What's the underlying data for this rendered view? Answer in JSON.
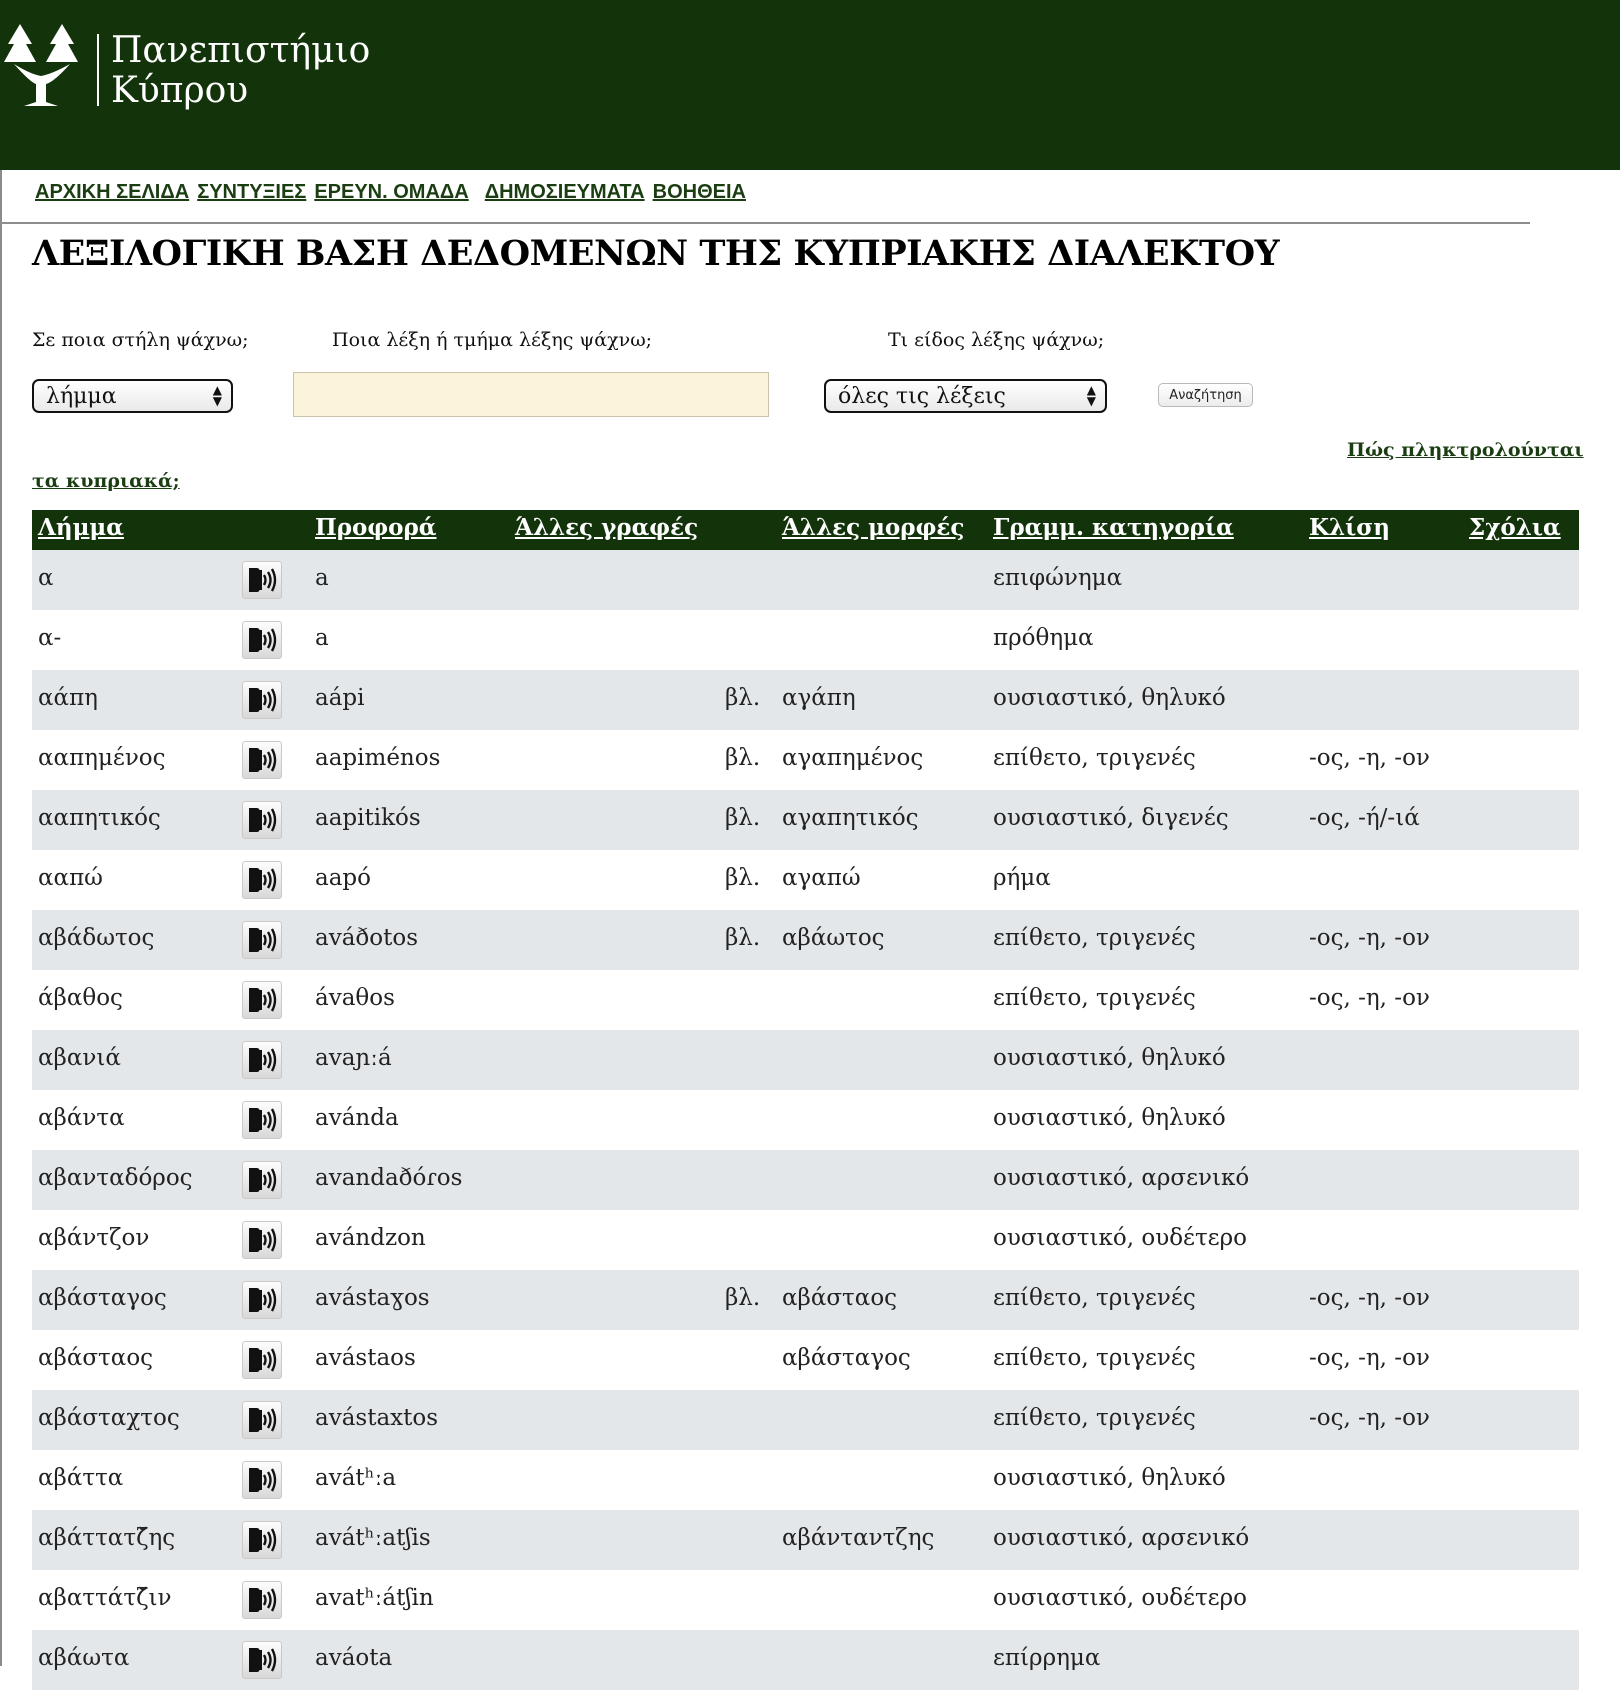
{
  "header": {
    "logo_line1": "Πανεπιστήμιο",
    "logo_line2": "Κύπρου",
    "bg_color": "#13340b"
  },
  "nav": {
    "items": [
      {
        "label": "ΑΡΧΙΚΗ ΣΕΛΙΔΑ"
      },
      {
        "label": "ΣΥΝΤΥΞΙΕΣ"
      },
      {
        "label": "ΕΡΕΥΝ. ΟΜΑΔΑ"
      },
      {
        "label": "ΔΗΜΟΣΙΕΥΜΑΤΑ"
      },
      {
        "label": "ΒΟΗΘΕΙΑ"
      }
    ]
  },
  "page": {
    "title": "ΛΕΞΙΛΟΓΙΚΗ ΒΑΣΗ ΔΕΔΟΜΕΝΩΝ ΤΗΣ ΚΥΠΡΙΑΚΗΣ ΔΙΑΛΕΚΤΟΥ"
  },
  "search": {
    "column_label": "Σε ποια στήλη ψάχνω;",
    "column_value": "λήμμα",
    "word_label": "Ποια λέξη ή τμήμα λέξης ψάχνω;",
    "word_value": "",
    "type_label": "Τι είδος λέξης ψάχνω;",
    "type_value": "όλες τις λέξεις",
    "button_label": "Αναζήτηση",
    "help_part1": "Πώς πληκτρολούνται",
    "help_part2": "τα κυπριακά;"
  },
  "table": {
    "headers": {
      "lemma": "Λήμμα",
      "pronunciation": "Προφορά",
      "other_spellings": "Άλλες γραφές",
      "other_forms": "Άλλες μορφές",
      "category": "Γραμμ. κατηγορία",
      "inflection": "Κλίση",
      "comments": "Σχόλια"
    },
    "audio_icon": "speaker-icon",
    "rows": [
      {
        "lemma": "α",
        "pron": "a",
        "see": "",
        "form": "",
        "cat": "επιφώνημα",
        "infl": ""
      },
      {
        "lemma": "α-",
        "pron": "a",
        "see": "",
        "form": "",
        "cat": "πρόθημα",
        "infl": ""
      },
      {
        "lemma": "αάπη",
        "pron": "aápi",
        "see": "βλ.",
        "form": "αγάπη",
        "cat": "ουσιαστικό, θηλυκό",
        "infl": ""
      },
      {
        "lemma": "ααπημένος",
        "pron": "aapiménos",
        "see": "βλ.",
        "form": "αγαπημένος",
        "cat": "επίθετο, τριγενές",
        "infl": "-ος, -η, -ον"
      },
      {
        "lemma": "ααπητικός",
        "pron": "aapitikós",
        "see": "βλ.",
        "form": "αγαπητικός",
        "cat": "ουσιαστικό, διγενές",
        "infl": "-ος, -ή/-ιά"
      },
      {
        "lemma": "ααπώ",
        "pron": "aapó",
        "see": "βλ.",
        "form": "αγαπώ",
        "cat": "ρήμα",
        "infl": ""
      },
      {
        "lemma": "αβάδωτος",
        "pron": "aváðotos",
        "see": "βλ.",
        "form": "αβάωτος",
        "cat": "επίθετο, τριγενές",
        "infl": "-ος, -η, -ον"
      },
      {
        "lemma": "άβαθος",
        "pron": "ávaθos",
        "see": "",
        "form": "",
        "cat": "επίθετο, τριγενές",
        "infl": "-ος, -η, -ον"
      },
      {
        "lemma": "αβανιά",
        "pron": "avaɲːá",
        "see": "",
        "form": "",
        "cat": "ουσιαστικό, θηλυκό",
        "infl": ""
      },
      {
        "lemma": "αβάντα",
        "pron": "avánda",
        "see": "",
        "form": "",
        "cat": "ουσιαστικό, θηλυκό",
        "infl": ""
      },
      {
        "lemma": "αβανταδόρος",
        "pron": "avandaðóɾos",
        "see": "",
        "form": "",
        "cat": "ουσιαστικό, αρσενικό",
        "infl": ""
      },
      {
        "lemma": "αβάντζον",
        "pron": "avándzon",
        "see": "",
        "form": "",
        "cat": "ουσιαστικό, ουδέτερο",
        "infl": ""
      },
      {
        "lemma": "αβάσταγος",
        "pron": "avástaɣos",
        "see": "βλ.",
        "form": "αβάσταος",
        "cat": "επίθετο, τριγενές",
        "infl": "-ος, -η, -ον"
      },
      {
        "lemma": "αβάσταος",
        "pron": "avástaos",
        "see": "",
        "form": "αβάσταγος",
        "cat": "επίθετο, τριγενές",
        "infl": "-ος, -η, -ον"
      },
      {
        "lemma": "αβάσταχτος",
        "pron": "avástaxtos",
        "see": "",
        "form": "",
        "cat": "επίθετο, τριγενές",
        "infl": "-ος, -η, -ον"
      },
      {
        "lemma": "αβάττα",
        "pron": "avátʰːa",
        "see": "",
        "form": "",
        "cat": "ουσιαστικό, θηλυκό",
        "infl": ""
      },
      {
        "lemma": "αβάττατζ̆ης",
        "pron": "avátʰːatʃis",
        "see": "",
        "form": "αβάνταντζης",
        "cat": "ουσιαστικό, αρσενικό",
        "infl": ""
      },
      {
        "lemma": "αβαττάτζ̆ιν",
        "pron": "avatʰːátʃin",
        "see": "",
        "form": "",
        "cat": "ουσιαστικό, ουδέτερο",
        "infl": ""
      },
      {
        "lemma": "αβάωτα",
        "pron": "aváota",
        "see": "",
        "form": "",
        "cat": "επίρρημα",
        "infl": ""
      }
    ]
  }
}
